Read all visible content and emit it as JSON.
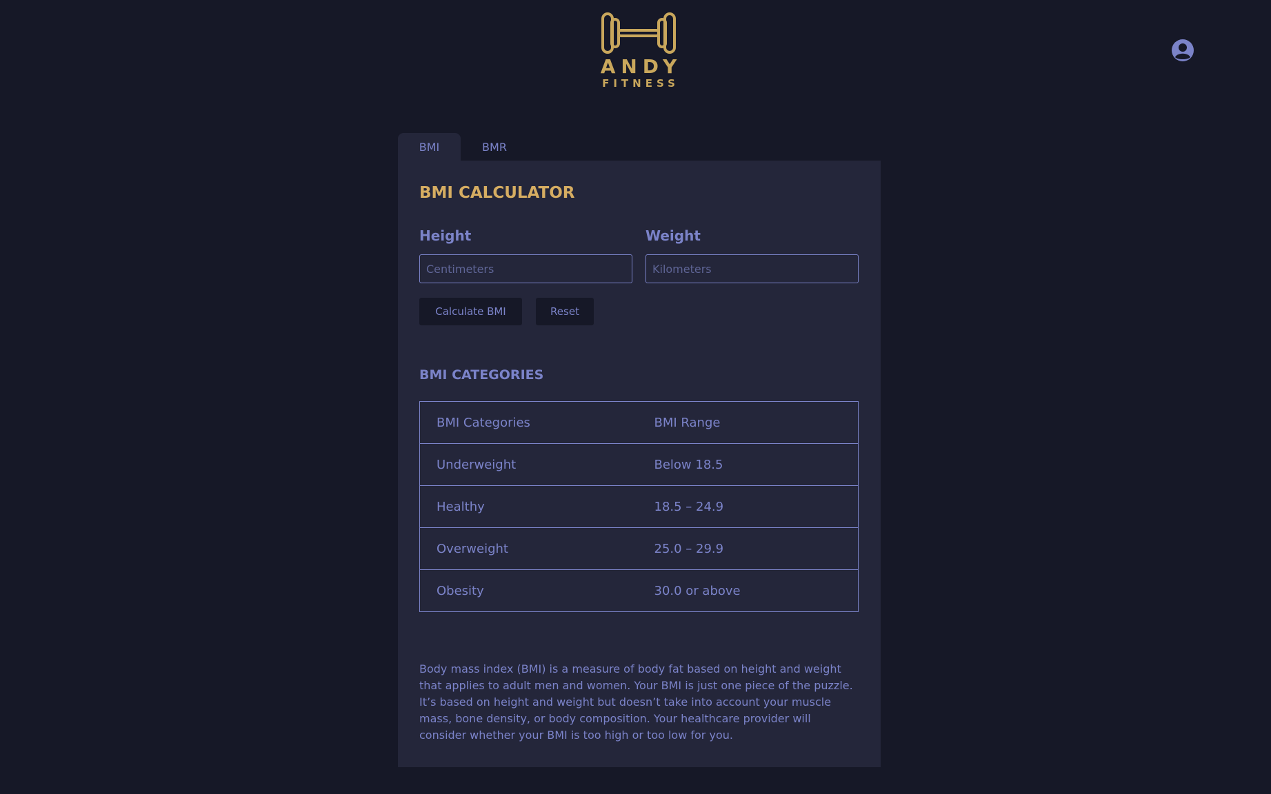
{
  "brand": {
    "name": "ANDY",
    "tagline": "FITNESS",
    "color": "#c9a75c"
  },
  "header": {
    "user_icon": "user-circle-icon"
  },
  "tabs": [
    {
      "label": "BMI",
      "active": true
    },
    {
      "label": "BMR",
      "active": false
    }
  ],
  "calculator": {
    "title": "BMI CALCULATOR",
    "height": {
      "label": "Height",
      "placeholder": "Centimeters",
      "value": ""
    },
    "weight": {
      "label": "Weight",
      "placeholder": "Kilometers",
      "value": ""
    },
    "calculate_label": "Calculate BMI",
    "reset_label": "Reset"
  },
  "categories": {
    "title": "BMI CATEGORIES",
    "headers": [
      "BMI Categories",
      "BMI Range"
    ],
    "rows": [
      [
        "Underweight",
        "Below 18.5"
      ],
      [
        "Healthy",
        "18.5 – 24.9"
      ],
      [
        "Overweight",
        "25.0 – 29.9"
      ],
      [
        "Obesity",
        "30.0 or above"
      ]
    ]
  },
  "description": "Body mass index (BMI) is a measure of body fat based on height and weight that applies to adult men and women. Your BMI is just one piece of the puzzle. It’s based on height and weight but doesn’t take into account your muscle mass, bone density, or body composition. Your healthcare provider will consider whether your BMI is too high or too low for you.",
  "colors": {
    "background": "#161827",
    "panel": "#24263a",
    "accent": "#d6ad62",
    "text": "#7b83c9"
  }
}
